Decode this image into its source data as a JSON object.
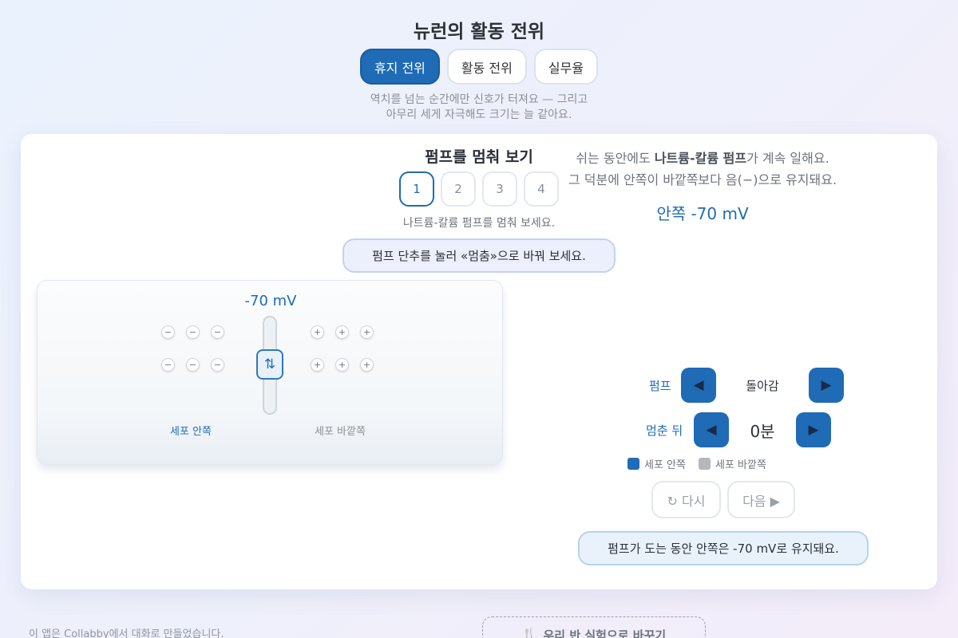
{
  "app_title": "뉴런의 활동 전위",
  "mode_tabs": [
    {
      "label": "휴지 전위",
      "active": true
    },
    {
      "label": "활동 전위",
      "active": false
    },
    {
      "label": "실무율",
      "active": false
    }
  ],
  "tagline": {
    "line1": "역치를 넘는 순간에만 신호가 터져요 — 그리고",
    "line2": "아무리 세게 자극해도 크기는 늘 같아요."
  },
  "card": {
    "title": "펌프를 멈춰 보기",
    "steps": [
      "1",
      "2",
      "3",
      "4"
    ],
    "active_step": 1,
    "step_description": "나트륨-칼륨 펌프를 멈춰 보세요.",
    "hint": "펌프 단추를 눌러 «멈춤»으로 바꿔 보세요."
  },
  "membrane": {
    "readout": "-70 mV",
    "inside_ion_symbol": "−",
    "outside_ion_symbol": "+",
    "pump_icon": "⇅",
    "inside_label": "세포 안쪽",
    "outside_label": "세포 바깥쪽"
  },
  "explanation": {
    "line1_pre": "쉬는 동안에도 ",
    "line1_bold": "나트륨-칼륨 펌프",
    "line1_post": "가 계속 일해요.",
    "line2": "그 덕분에 안쪽이 바깥쪽보다 음(−)으로 유지돼요."
  },
  "inside_readout": "안쪽 -70 mV",
  "controls": {
    "pump_label": "펌프",
    "pump_value": "돌아감",
    "elapsed_label": "멈춘 뒤",
    "elapsed_value": "0분",
    "prev_symbol": "◀",
    "next_symbol": "▶"
  },
  "legend": {
    "inside": {
      "label": "세포 안쪽",
      "color": "#1f6bb5"
    },
    "outside": {
      "label": "세포 바깥쪽",
      "color": "#b4b8bd"
    }
  },
  "actions": {
    "reset_label": "↻ 다시",
    "next_label": "다음 ▶"
  },
  "status_message": "펌프가 도는 동안 안쪽은 -70 mV로 유지돼요.",
  "footer": {
    "note": "이 앱은 Collabby에서 대화로 만들었습니다.",
    "swap_icon": "🍴",
    "swap_label": "우리 반 실험으로 바꾸기"
  }
}
